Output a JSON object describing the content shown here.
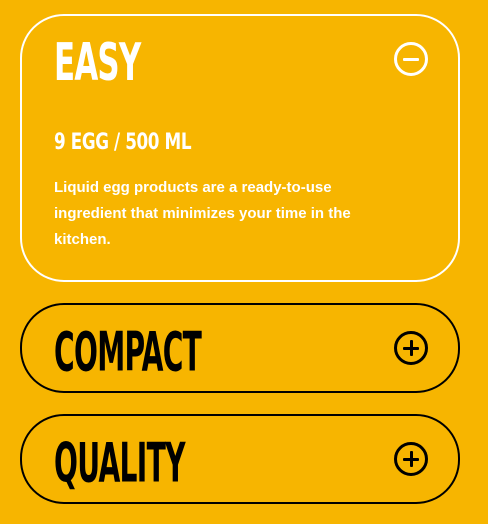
{
  "accordion": {
    "items": [
      {
        "title": "EASY",
        "expanded": true,
        "toggle_icon": "minus-circle-icon",
        "subtitle": "9 EGG / 500 ML",
        "description": "Liquid egg products are a ready-to-use ingredient that minimizes your time in the kitchen."
      },
      {
        "title": "COMPACT",
        "expanded": false,
        "toggle_icon": "plus-circle-icon"
      },
      {
        "title": "QUALITY",
        "expanded": false,
        "toggle_icon": "plus-circle-icon"
      }
    ]
  },
  "colors": {
    "background": "#F7B500",
    "expanded_foreground": "#FFFFFF",
    "collapsed_foreground": "#000000"
  }
}
